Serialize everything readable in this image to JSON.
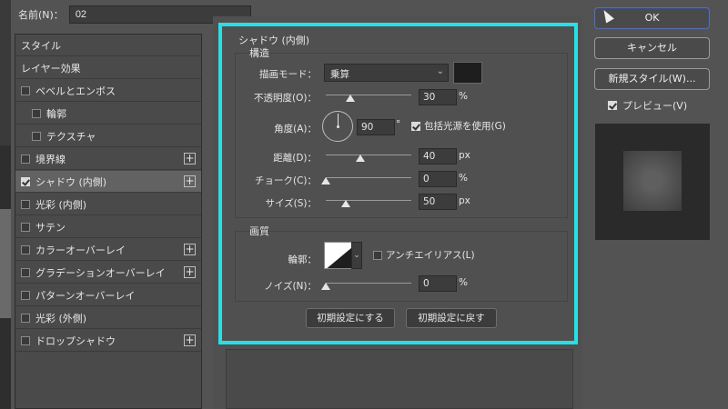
{
  "dialog": {
    "name_label": "名前(N)：",
    "name_value": "02"
  },
  "styles_list": [
    {
      "label": "スタイル",
      "checkbox": false,
      "checked": false,
      "plus": false,
      "indent": 0
    },
    {
      "label": "レイヤー効果",
      "checkbox": false,
      "checked": false,
      "plus": false,
      "indent": 0
    },
    {
      "label": "ベベルとエンボス",
      "checkbox": true,
      "checked": false,
      "plus": false,
      "indent": 0
    },
    {
      "label": "輪郭",
      "checkbox": true,
      "checked": false,
      "plus": false,
      "indent": 1
    },
    {
      "label": "テクスチャ",
      "checkbox": true,
      "checked": false,
      "plus": false,
      "indent": 1
    },
    {
      "label": "境界線",
      "checkbox": true,
      "checked": false,
      "plus": true,
      "indent": 0
    },
    {
      "label": "シャドウ (内側)",
      "checkbox": true,
      "checked": true,
      "plus": true,
      "indent": 0,
      "selected": true
    },
    {
      "label": "光彩 (内側)",
      "checkbox": true,
      "checked": false,
      "plus": false,
      "indent": 0
    },
    {
      "label": "サテン",
      "checkbox": true,
      "checked": false,
      "plus": false,
      "indent": 0
    },
    {
      "label": "カラーオーバーレイ",
      "checkbox": true,
      "checked": false,
      "plus": true,
      "indent": 0
    },
    {
      "label": "グラデーションオーバーレイ",
      "checkbox": true,
      "checked": false,
      "plus": true,
      "indent": 0
    },
    {
      "label": "パターンオーバーレイ",
      "checkbox": true,
      "checked": false,
      "plus": false,
      "indent": 0
    },
    {
      "label": "光彩 (外側)",
      "checkbox": true,
      "checked": false,
      "plus": false,
      "indent": 0
    },
    {
      "label": "ドロップシャドウ",
      "checkbox": true,
      "checked": false,
      "plus": true,
      "indent": 0
    }
  ],
  "inner_shadow": {
    "title": "シャドウ (内側)",
    "structure_title": "構造",
    "blend_mode_label": "描画モード：",
    "blend_mode_value": "乗算",
    "blend_color": "#1e1e1e",
    "opacity_label": "不透明度(O)：",
    "opacity_value": "30",
    "opacity_unit": "%",
    "angle_label": "角度(A)：",
    "angle_value": "90",
    "angle_unit": "°",
    "global_light_label": "包括光源を使用(G)",
    "global_light_checked": true,
    "distance_label": "距離(D)：",
    "distance_value": "40",
    "distance_unit": "px",
    "choke_label": "チョーク(C)：",
    "choke_value": "0",
    "choke_unit": "%",
    "size_label": "サイズ(S)：",
    "size_value": "50",
    "size_unit": "px",
    "quality_title": "画質",
    "contour_label": "輪郭：",
    "antialias_label": "アンチエイリアス(L)",
    "antialias_checked": false,
    "noise_label": "ノイズ(N)：",
    "noise_value": "0",
    "noise_unit": "%",
    "make_default_label": "初期設定にする",
    "reset_default_label": "初期設定に戻す"
  },
  "right_buttons": {
    "ok": "OK",
    "cancel": "キャンセル",
    "new_style": "新規スタイル(W)...",
    "preview_label": "プレビュー(V)",
    "preview_checked": true
  },
  "colors": {
    "highlight": "#26e0e8",
    "panel": "#505050"
  }
}
